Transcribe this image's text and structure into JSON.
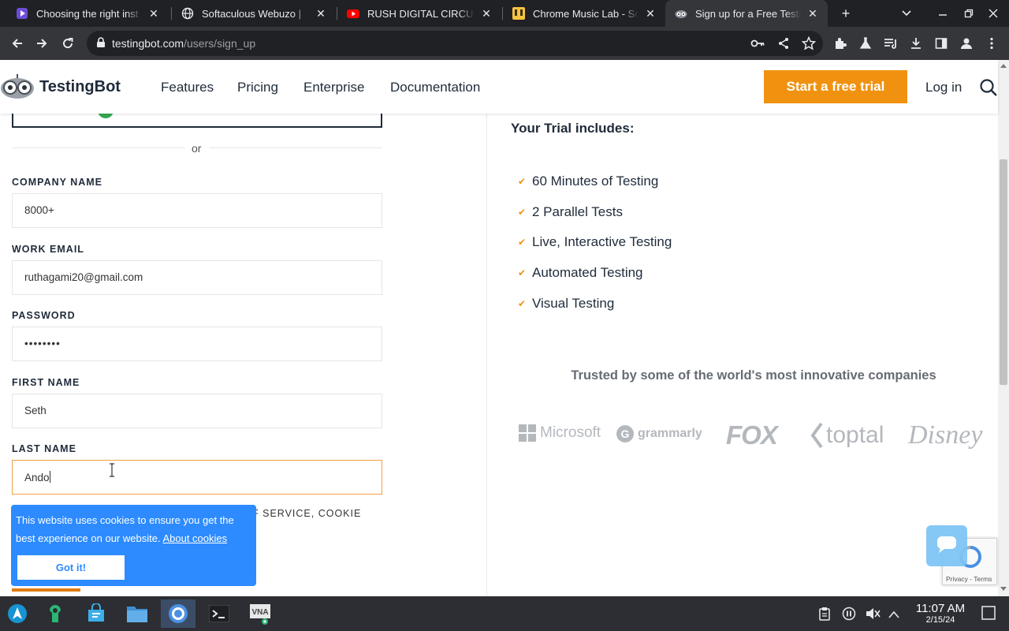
{
  "browser": {
    "tabs": [
      {
        "title": "Choosing the right inst",
        "favicon": "purple-play-icon",
        "active": false
      },
      {
        "title": "Softaculous Webuzo | ",
        "favicon": "globe-icon",
        "active": false
      },
      {
        "title": "RUSH DIGITAL CIRCUS",
        "favicon": "youtube-icon",
        "active": false
      },
      {
        "title": "Chrome Music Lab - So",
        "favicon": "music-lab-icon",
        "active": false
      },
      {
        "title": "Sign up for a Free Testi",
        "favicon": "testingbot-icon",
        "active": true
      }
    ],
    "url_host": "testingbot.com",
    "url_path": "/users/sign_up"
  },
  "site": {
    "brand": "TestingBot",
    "nav": [
      "Features",
      "Pricing",
      "Enterprise",
      "Documentation"
    ],
    "cta": "Start a free trial",
    "login": "Log in"
  },
  "form": {
    "or": "or",
    "fields": [
      {
        "label": "COMPANY NAME",
        "value": "8000+"
      },
      {
        "label": "WORK EMAIL",
        "value": "ruthagami20@gmail.com"
      },
      {
        "label": "PASSWORD",
        "value": "••••••••"
      },
      {
        "label": "FIRST NAME",
        "value": "Seth"
      },
      {
        "label": "LAST NAME",
        "value": "Ando"
      }
    ],
    "terms_fragment": "F SERVICE, COOKIE"
  },
  "trial": {
    "heading": "Your Trial includes:",
    "features": [
      "60 Minutes of Testing",
      "2 Parallel Tests",
      "Live, Interactive Testing",
      "Automated Testing",
      "Visual Testing"
    ],
    "trusted": "Trusted by some of the world's most innovative companies",
    "brands": [
      "Microsoft",
      "grammarly",
      "FOX",
      "toptal",
      "Disney"
    ]
  },
  "cookie": {
    "message": "This website uses cookies to ensure you get the best experience on our website.",
    "link": "About cookies",
    "button": "Got it!"
  },
  "recaptcha": {
    "text": "Privacy - Terms"
  },
  "taskbar": {
    "time": "11:07 AM",
    "date": "2/15/24"
  },
  "colors": {
    "accent": "#f0920f",
    "cookie_bg": "#2d8bff",
    "brand_logo": "#b4b8bd"
  }
}
